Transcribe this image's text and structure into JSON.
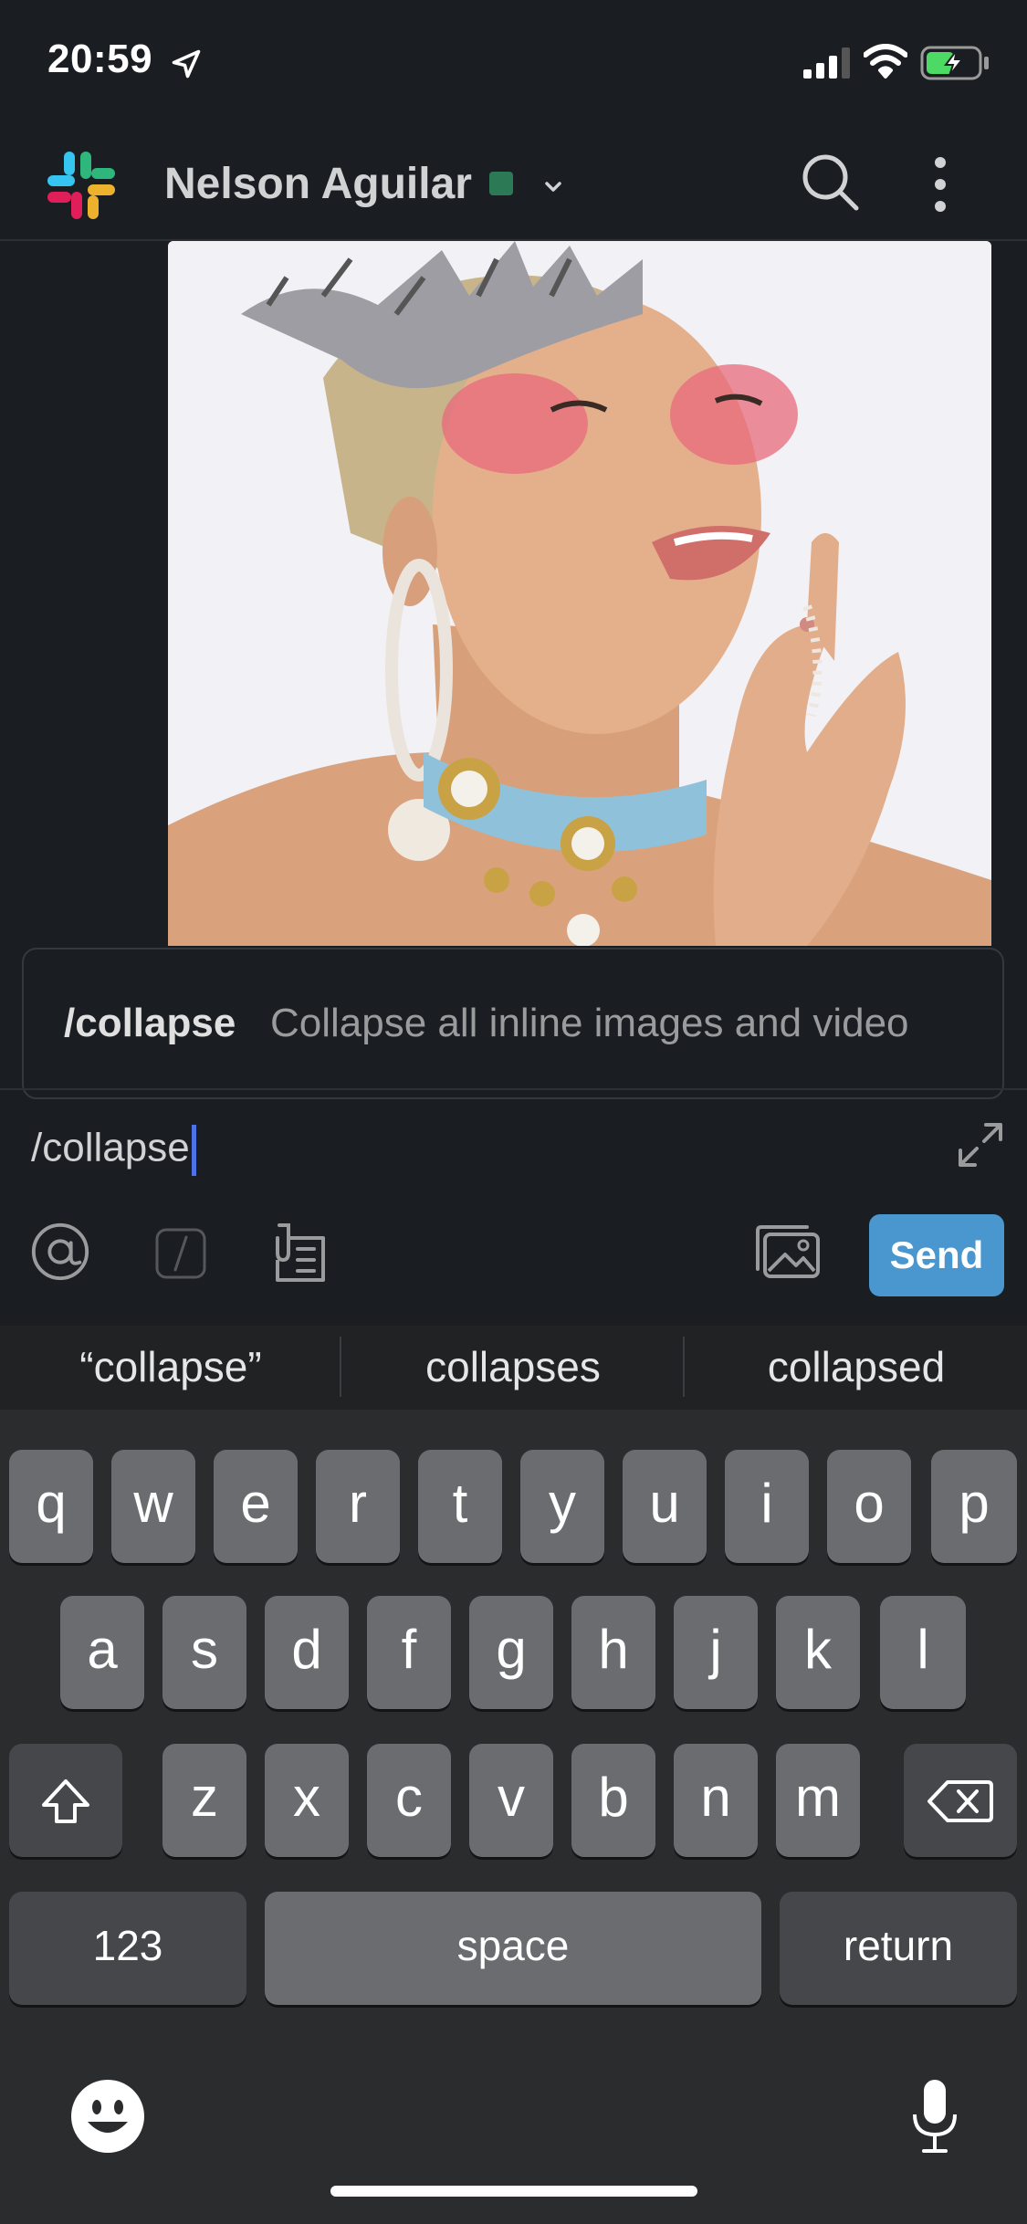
{
  "status_bar": {
    "time": "20:59",
    "icons": [
      "location-arrow-icon",
      "cellular-signal-icon",
      "wifi-icon",
      "battery-charging-icon"
    ]
  },
  "header": {
    "title": "Nelson Aguilar",
    "presence_color": "#2b7a55",
    "icons": [
      "slack-logo-icon",
      "chevron-down-icon",
      "search-icon",
      "more-vertical-icon"
    ]
  },
  "message": {
    "image_alt": "photo"
  },
  "suggestion": {
    "command": "/collapse",
    "description": "Collapse all inline images and video"
  },
  "composer": {
    "value": "/collapse",
    "send_label": "Send",
    "send_color": "#4a97d0",
    "tools": [
      "mention-icon",
      "slash-command-icon",
      "attachment-icon",
      "photo-gallery-icon",
      "expand-icon"
    ]
  },
  "keyboard": {
    "predictions": [
      "“collapse”",
      "collapses",
      "collapsed"
    ],
    "row1": [
      "q",
      "w",
      "e",
      "r",
      "t",
      "y",
      "u",
      "i",
      "o",
      "p"
    ],
    "row2": [
      "a",
      "s",
      "d",
      "f",
      "g",
      "h",
      "j",
      "k",
      "l"
    ],
    "row3": [
      "z",
      "x",
      "c",
      "v",
      "b",
      "n",
      "m"
    ],
    "numbers_label": "123",
    "space_label": "space",
    "return_label": "return",
    "icons": [
      "shift-icon",
      "backspace-icon",
      "emoji-icon",
      "microphone-icon"
    ]
  },
  "colors": {
    "background": "#1a1d21",
    "keyboard_bg": "#2b2c2e",
    "key": "#6b6c6f",
    "caret": "#4c72e6"
  }
}
